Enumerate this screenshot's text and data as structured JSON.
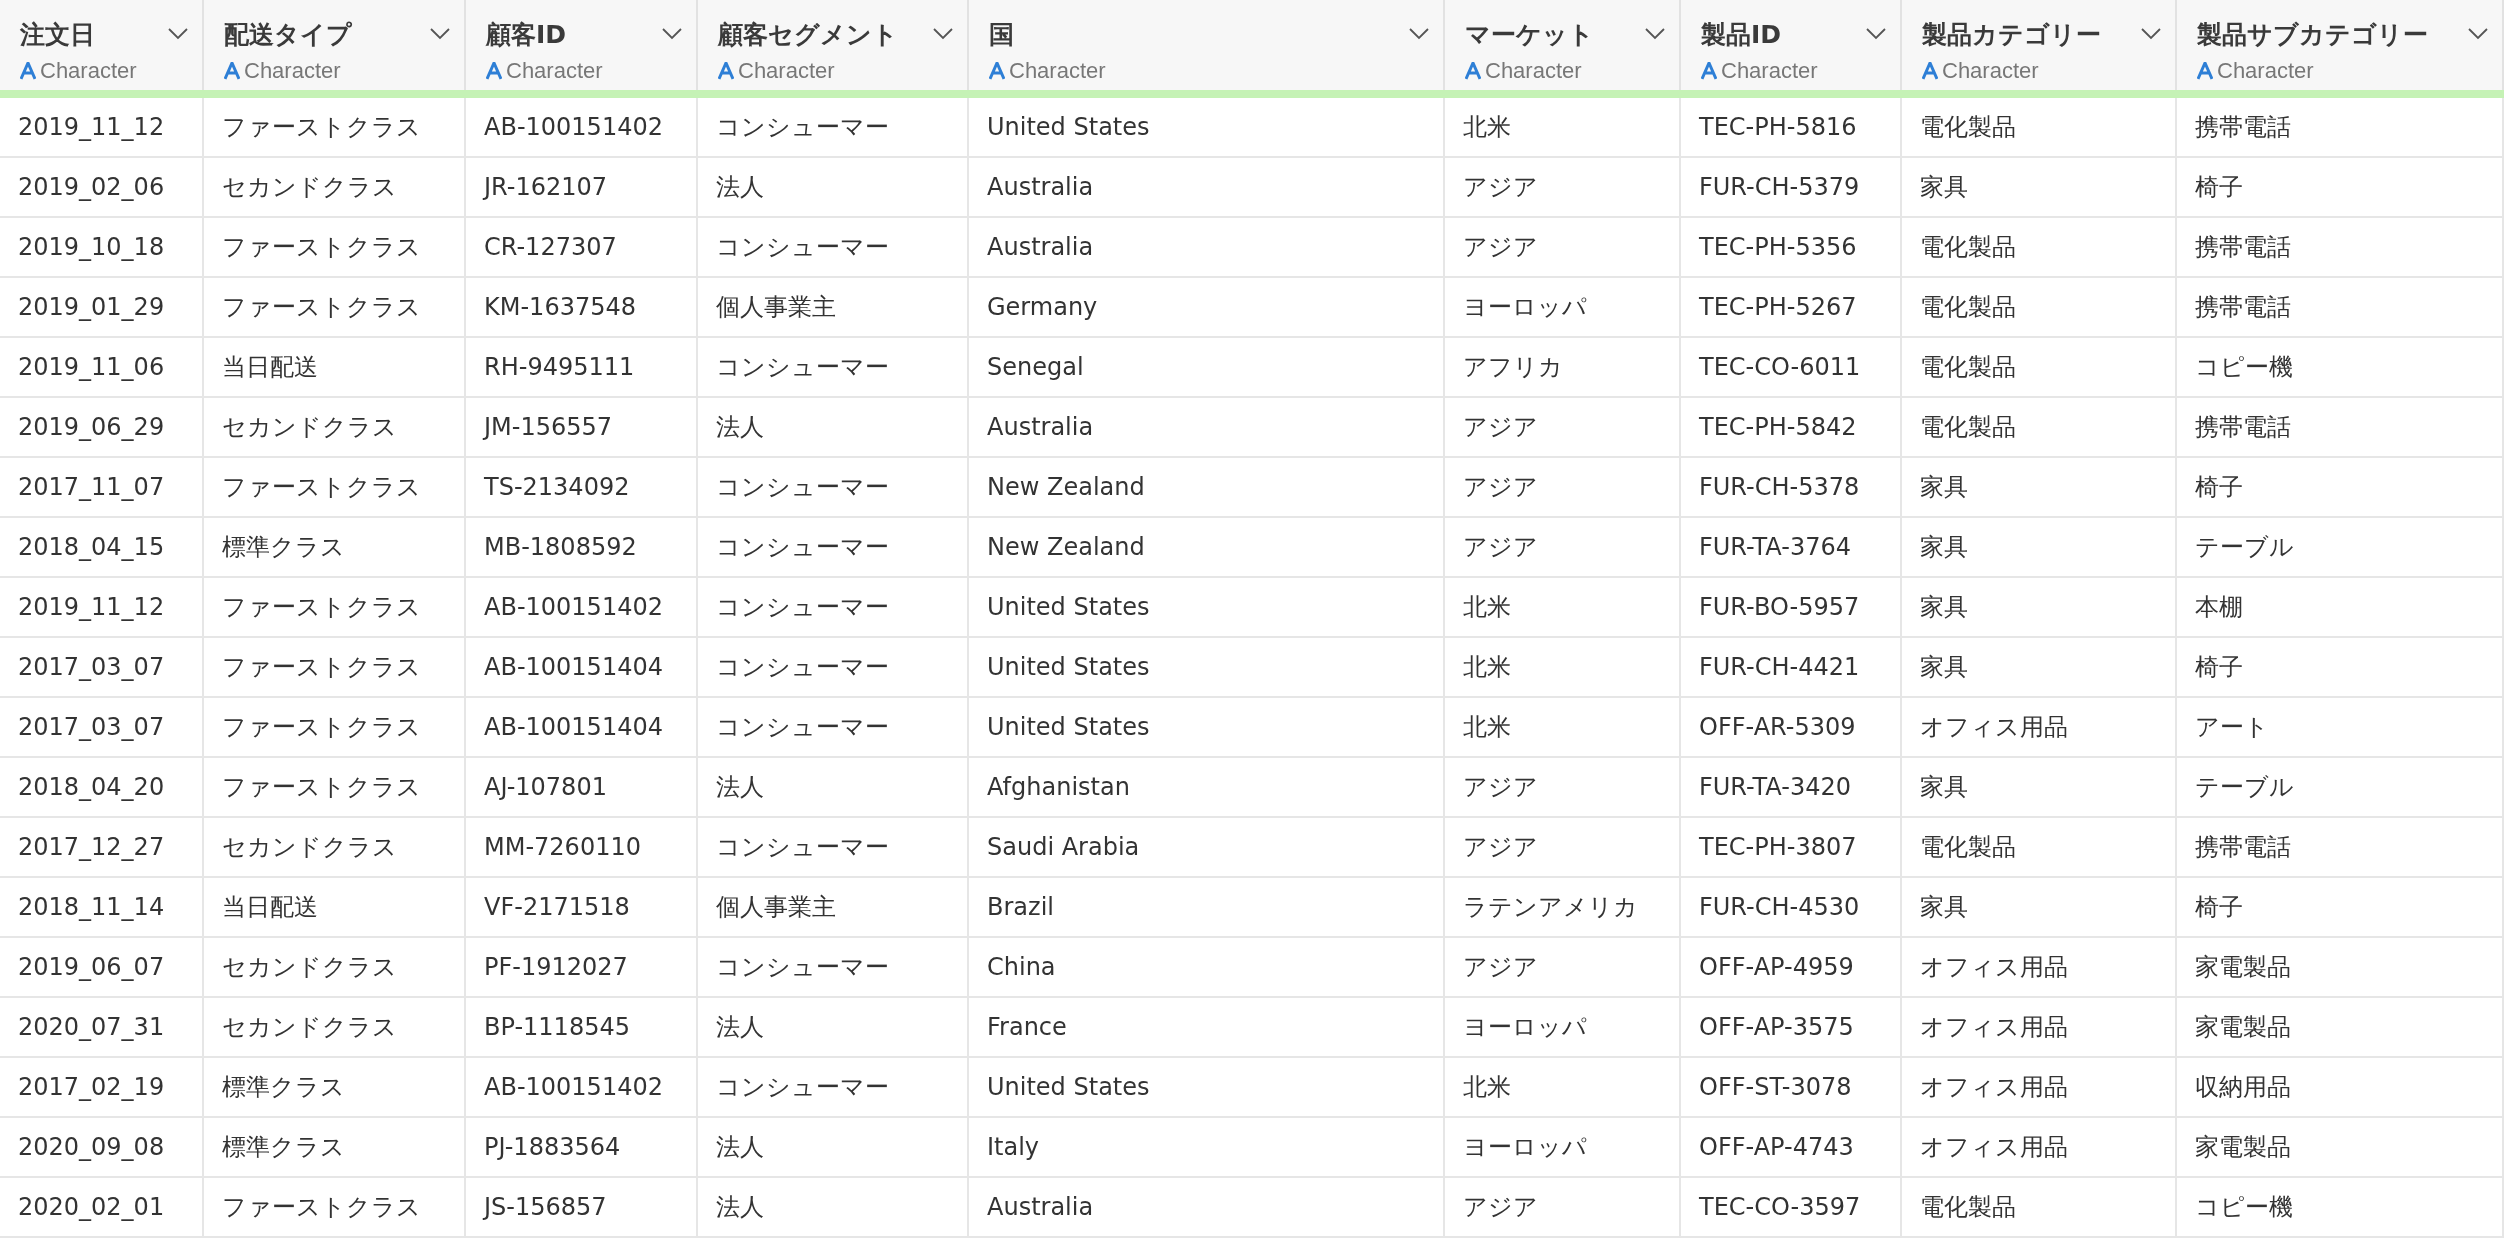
{
  "table": {
    "columns": [
      {
        "name": "注文日",
        "type": "Character"
      },
      {
        "name": "配送タイプ",
        "type": "Character"
      },
      {
        "name": "顧客ID",
        "type": "Character"
      },
      {
        "name": "顧客セグメント",
        "type": "Character"
      },
      {
        "name": "国",
        "type": "Character"
      },
      {
        "name": "マーケット",
        "type": "Character"
      },
      {
        "name": "製品ID",
        "type": "Character"
      },
      {
        "name": "製品カテゴリー",
        "type": "Character"
      },
      {
        "name": "製品サブカテゴリー",
        "type": "Character"
      }
    ],
    "rows": [
      [
        "2019_11_12",
        "ファーストクラス",
        "AB-100151402",
        "コンシューマー",
        "United States",
        "北米",
        "TEC-PH-5816",
        "電化製品",
        "携帯電話"
      ],
      [
        "2019_02_06",
        "セカンドクラス",
        "JR-162107",
        "法人",
        "Australia",
        "アジア",
        "FUR-CH-5379",
        "家具",
        "椅子"
      ],
      [
        "2019_10_18",
        "ファーストクラス",
        "CR-127307",
        "コンシューマー",
        "Australia",
        "アジア",
        "TEC-PH-5356",
        "電化製品",
        "携帯電話"
      ],
      [
        "2019_01_29",
        "ファーストクラス",
        "KM-1637548",
        "個人事業主",
        "Germany",
        "ヨーロッパ",
        "TEC-PH-5267",
        "電化製品",
        "携帯電話"
      ],
      [
        "2019_11_06",
        "当日配送",
        "RH-9495111",
        "コンシューマー",
        "Senegal",
        "アフリカ",
        "TEC-CO-6011",
        "電化製品",
        "コピー機"
      ],
      [
        "2019_06_29",
        "セカンドクラス",
        "JM-156557",
        "法人",
        "Australia",
        "アジア",
        "TEC-PH-5842",
        "電化製品",
        "携帯電話"
      ],
      [
        "2017_11_07",
        "ファーストクラス",
        "TS-2134092",
        "コンシューマー",
        "New Zealand",
        "アジア",
        "FUR-CH-5378",
        "家具",
        "椅子"
      ],
      [
        "2018_04_15",
        "標準クラス",
        "MB-1808592",
        "コンシューマー",
        "New Zealand",
        "アジア",
        "FUR-TA-3764",
        "家具",
        "テーブル"
      ],
      [
        "2019_11_12",
        "ファーストクラス",
        "AB-100151402",
        "コンシューマー",
        "United States",
        "北米",
        "FUR-BO-5957",
        "家具",
        "本棚"
      ],
      [
        "2017_03_07",
        "ファーストクラス",
        "AB-100151404",
        "コンシューマー",
        "United States",
        "北米",
        "FUR-CH-4421",
        "家具",
        "椅子"
      ],
      [
        "2017_03_07",
        "ファーストクラス",
        "AB-100151404",
        "コンシューマー",
        "United States",
        "北米",
        "OFF-AR-5309",
        "オフィス用品",
        "アート"
      ],
      [
        "2018_04_20",
        "ファーストクラス",
        "AJ-107801",
        "法人",
        "Afghanistan",
        "アジア",
        "FUR-TA-3420",
        "家具",
        "テーブル"
      ],
      [
        "2017_12_27",
        "セカンドクラス",
        "MM-7260110",
        "コンシューマー",
        "Saudi Arabia",
        "アジア",
        "TEC-PH-3807",
        "電化製品",
        "携帯電話"
      ],
      [
        "2018_11_14",
        "当日配送",
        "VF-2171518",
        "個人事業主",
        "Brazil",
        "ラテンアメリカ",
        "FUR-CH-4530",
        "家具",
        "椅子"
      ],
      [
        "2019_06_07",
        "セカンドクラス",
        "PF-1912027",
        "コンシューマー",
        "China",
        "アジア",
        "OFF-AP-4959",
        "オフィス用品",
        "家電製品"
      ],
      [
        "2020_07_31",
        "セカンドクラス",
        "BP-1118545",
        "法人",
        "France",
        "ヨーロッパ",
        "OFF-AP-3575",
        "オフィス用品",
        "家電製品"
      ],
      [
        "2017_02_19",
        "標準クラス",
        "AB-100151402",
        "コンシューマー",
        "United States",
        "北米",
        "OFF-ST-3078",
        "オフィス用品",
        "収納用品"
      ],
      [
        "2020_09_08",
        "標準クラス",
        "PJ-1883564",
        "法人",
        "Italy",
        "ヨーロッパ",
        "OFF-AP-4743",
        "オフィス用品",
        "家電製品"
      ],
      [
        "2020_02_01",
        "ファーストクラス",
        "JS-156857",
        "法人",
        "Australia",
        "アジア",
        "TEC-CO-3597",
        "電化製品",
        "コピー機"
      ]
    ]
  }
}
